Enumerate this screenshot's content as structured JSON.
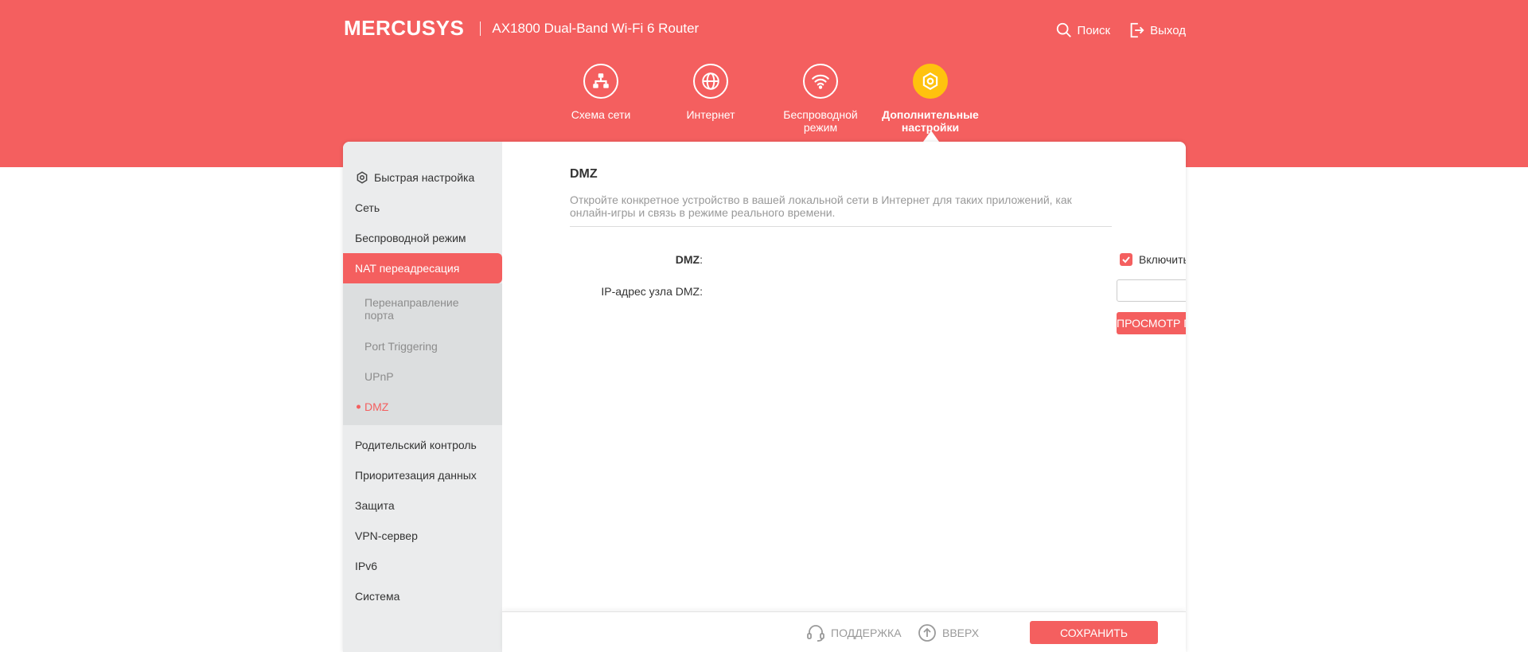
{
  "header": {
    "brand": "MERCUSYS",
    "model": "AX1800 Dual-Band Wi-Fi 6 Router",
    "search_label": "Поиск",
    "logout_label": "Выход",
    "color": "#f45f5f"
  },
  "nav": {
    "items": [
      {
        "label": "Схема сети",
        "icon": "network-map-icon"
      },
      {
        "label": "Интернет",
        "icon": "globe-icon"
      },
      {
        "label": "Беспроводной режим",
        "icon": "wifi-icon"
      },
      {
        "label": "Дополнительные настройки",
        "icon": "gear-icon",
        "active": true
      }
    ]
  },
  "sidebar": {
    "items": [
      {
        "label": "Быстрая настройка"
      },
      {
        "label": "Сеть"
      },
      {
        "label": "Беспроводной режим"
      },
      {
        "label": "NAT переадресация",
        "active": true
      }
    ],
    "subitems": [
      {
        "label": "Перенаправление порта"
      },
      {
        "label": "Port Triggering"
      },
      {
        "label": "UPnP"
      },
      {
        "label": "DMZ",
        "active": true
      }
    ],
    "lower_items": [
      {
        "label": "Родительский контроль"
      },
      {
        "label": "Приоритезация данных"
      },
      {
        "label": "Защита"
      },
      {
        "label": "VPN-сервер"
      },
      {
        "label": "IPv6"
      },
      {
        "label": "Система"
      }
    ]
  },
  "main": {
    "title": "DMZ",
    "description": "Откройте конкретное устройство в вашей локальной сети в Интернет для таких приложений, как онлайн-игры и связь в режиме реального времени.",
    "dmz_label": "DMZ",
    "dmz_colon": ":",
    "enable_label": "Включить",
    "enable_checked": true,
    "ip_label": "IP-адрес узла DMZ:",
    "ip_value": "",
    "view_button": "Просмотр подключенных устройств"
  },
  "footer": {
    "support_label": "Поддержка",
    "top_label": "Вверх",
    "save_label": "Сохранить"
  }
}
